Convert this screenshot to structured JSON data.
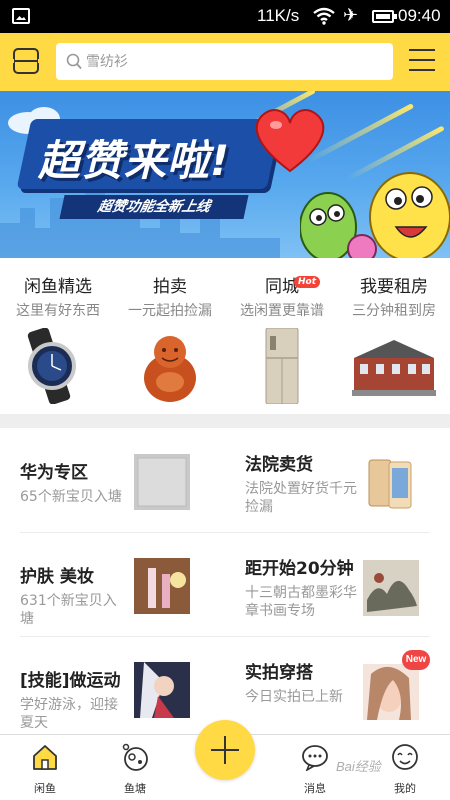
{
  "status_bar": {
    "network_speed": "11K/s",
    "time": "09:40",
    "icons": [
      "image-icon",
      "wifi-icon",
      "airplane-icon",
      "battery-icon"
    ]
  },
  "header": {
    "search_placeholder": "雪纺衫",
    "icons": [
      "scan-icon",
      "search-icon",
      "menu-icon"
    ],
    "accent_color": "#ffda44"
  },
  "banner": {
    "title": "超赞来啦!",
    "subtitle": "超赞功能全新上线"
  },
  "categories": [
    {
      "title": "闲鱼精选",
      "subtitle": "这里有好东西",
      "image": "wristwatch"
    },
    {
      "title": "拍卖",
      "subtitle": "一元起拍捡漏",
      "image": "carved-buddha"
    },
    {
      "title": "同城",
      "subtitle": "选闲置更靠谱",
      "badge": "Hot",
      "image": "refrigerator"
    },
    {
      "title": "我要租房",
      "subtitle": "三分钟租到房",
      "image": "row-houses"
    }
  ],
  "feed": [
    {
      "title": "华为专区",
      "desc": "65个新宝贝入塘",
      "image": "phone-box"
    },
    {
      "title": "法院卖货",
      "desc": "法院处置好货千元捡漏",
      "image": "smartphone"
    },
    {
      "title": "护肤 美妆",
      "desc": "631个新宝贝入塘",
      "image": "cosmetics"
    },
    {
      "title": "距开始20分钟",
      "desc": "十三朝古都墨彩华章书画专场",
      "image": "ink-painting"
    },
    {
      "title": "[技能]做运动",
      "desc": "学好游泳，迎接夏天",
      "image": "anime-figure"
    },
    {
      "title": "实拍穿搭",
      "desc": "今日实拍已上新",
      "badge": "New",
      "image": "portrait"
    }
  ],
  "tabbar": {
    "tabs": [
      {
        "label": "闲鱼",
        "icon": "home-icon",
        "active": true
      },
      {
        "label": "鱼塘",
        "icon": "fish-pond-icon"
      },
      {
        "label": "消息",
        "icon": "message-icon"
      },
      {
        "label": "我的",
        "icon": "profile-icon"
      }
    ],
    "publish_icon": "plus-icon"
  },
  "watermark": "Bai经验"
}
